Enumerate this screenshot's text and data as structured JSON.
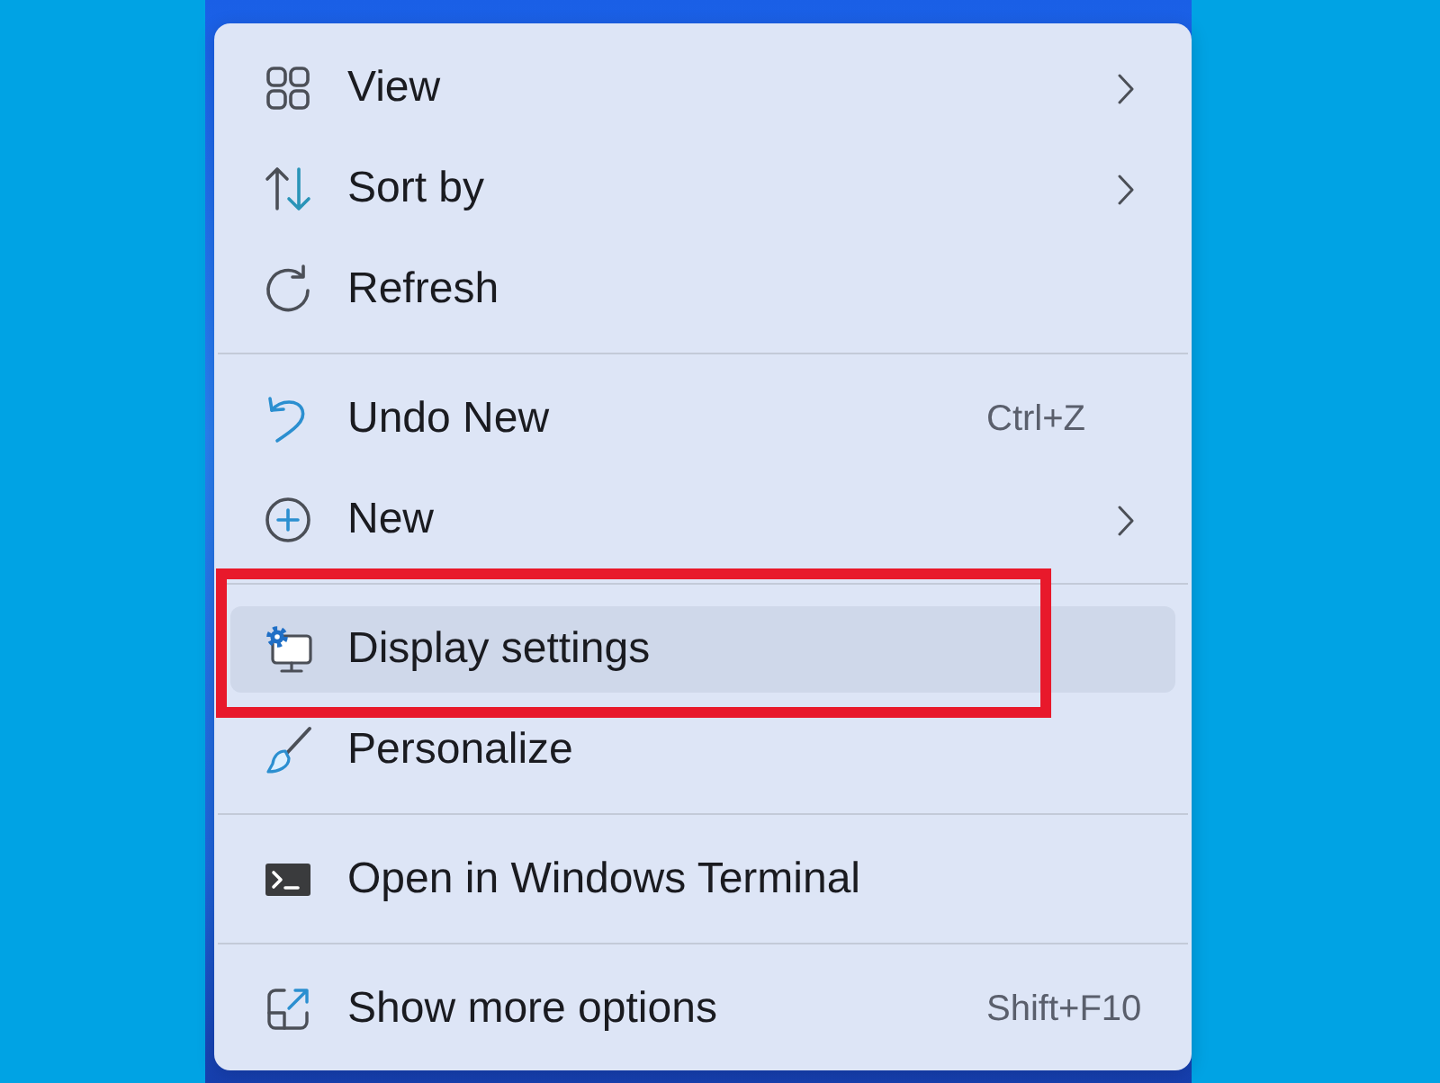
{
  "context_menu": {
    "groups": [
      {
        "items": [
          {
            "label": "View",
            "submenu": true,
            "selected": false,
            "annotation_box": false
          },
          {
            "label": "Sort by",
            "submenu": true,
            "selected": false,
            "annotation_box": false
          },
          {
            "label": "Refresh",
            "submenu": false,
            "selected": false,
            "annotation_box": false
          }
        ]
      },
      {
        "items": [
          {
            "label": "Undo New",
            "shortcut": "Ctrl+Z",
            "submenu": false,
            "selected": false,
            "annotation_box": false
          },
          {
            "label": "New",
            "submenu": true,
            "selected": false,
            "annotation_box": false
          }
        ]
      },
      {
        "items": [
          {
            "label": "Display settings",
            "submenu": false,
            "selected": true,
            "annotation_box": true
          },
          {
            "label": "Personalize",
            "submenu": false,
            "selected": false,
            "annotation_box": false
          }
        ]
      },
      {
        "items": [
          {
            "label": "Open in Windows Terminal",
            "submenu": false,
            "selected": false,
            "annotation_box": false
          }
        ]
      },
      {
        "items": [
          {
            "label": "Show more options",
            "shortcut": "Shift+F10",
            "submenu": false,
            "selected": false,
            "annotation_box": false
          }
        ]
      }
    ]
  }
}
